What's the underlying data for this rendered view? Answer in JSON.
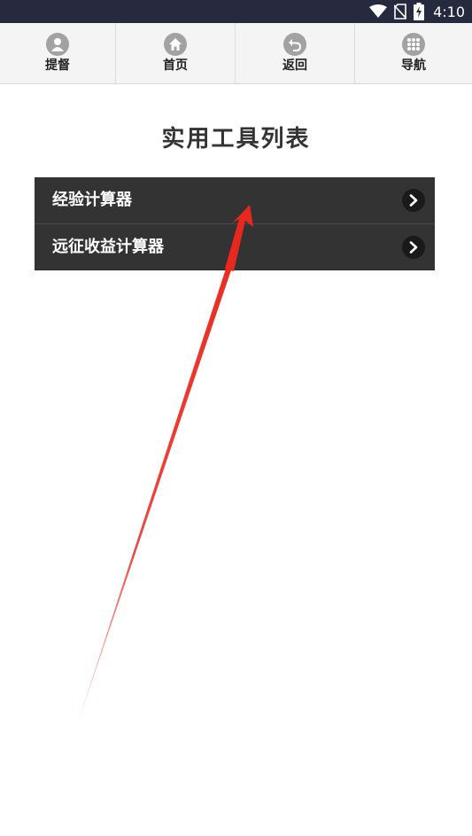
{
  "status_bar": {
    "time": "4:10",
    "icons": [
      "wifi-icon",
      "no-sim-icon",
      "battery-charging-icon"
    ]
  },
  "nav": {
    "items": [
      {
        "label": "提督",
        "icon": "person-icon"
      },
      {
        "label": "首页",
        "icon": "home-icon"
      },
      {
        "label": "返回",
        "icon": "back-icon"
      },
      {
        "label": "导航",
        "icon": "grid-icon"
      }
    ]
  },
  "page": {
    "title": "实用工具列表"
  },
  "tools": [
    {
      "label": "经验计算器",
      "icon": "chevron-right-icon"
    },
    {
      "label": "远征收益计算器",
      "icon": "chevron-right-icon"
    }
  ],
  "colors": {
    "status_bar": "#262a3e",
    "nav_bg": "#f4f4f4",
    "nav_icon": "#a2a2a2",
    "list_bg": "#333333",
    "arrow": "#e8281e"
  }
}
